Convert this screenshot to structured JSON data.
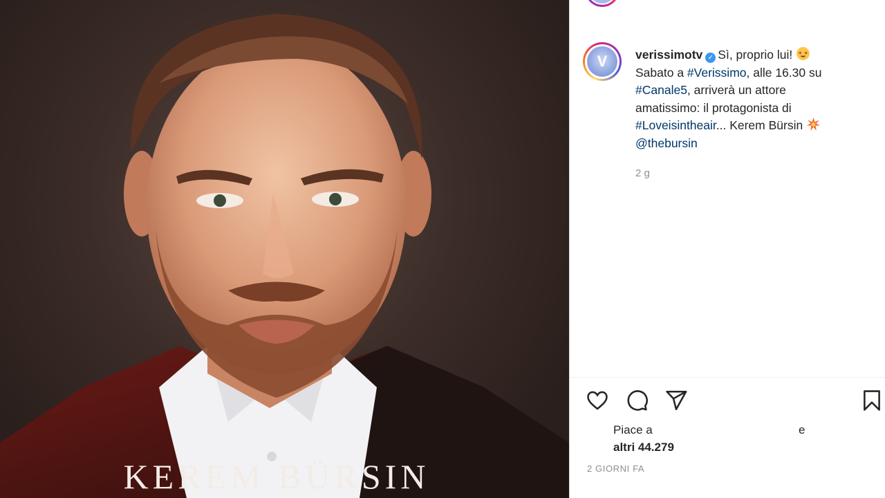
{
  "photo": {
    "name_overlay": "KEREM BÜRSIN"
  },
  "post": {
    "username": "verissimotv",
    "verified_icon": "check-icon",
    "caption_line1": "Sì, proprio lui!",
    "caption_sabato": "Sabato a ",
    "hashtag_verissimo": "#Verissimo",
    "caption_alle": ", alle 16.30 su",
    "hashtag_canale5": "#Canale5",
    "caption_arrivera": ", arriverà un attore",
    "caption_amatissimo": "amatissimo: il protagonista di",
    "hashtag_love": "#Loveisintheair",
    "caption_kerem": "... Kerem Bürsin",
    "mention": "@thebursin",
    "time_short": "2 g"
  },
  "likes": {
    "prefix": "Piace a",
    "suffix": "e",
    "others": "altri 44.279"
  },
  "time_long": "2 GIORNI FA",
  "colors": {
    "link": "#00376b",
    "verified": "#3897f0",
    "muted": "#8e8e8e"
  },
  "icons": [
    "heart-icon",
    "comment-icon",
    "share-icon",
    "bookmark-icon"
  ]
}
